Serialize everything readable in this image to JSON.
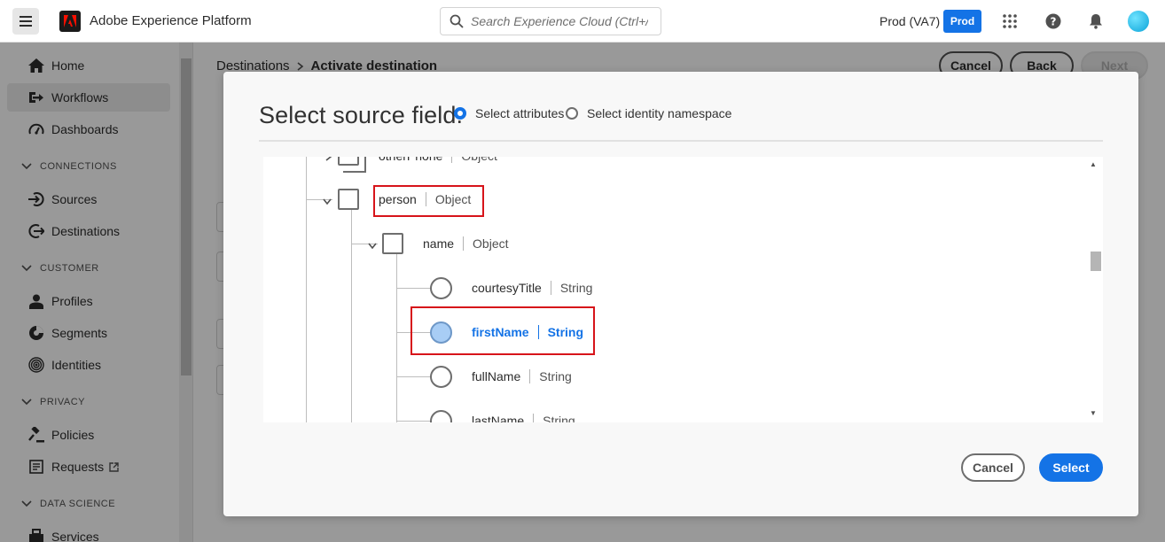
{
  "header": {
    "app_title": "Adobe Experience Platform",
    "search_placeholder": "Search Experience Cloud (Ctrl+/)",
    "sandbox_name": "Prod (VA7)",
    "sandbox_badge": "Prod"
  },
  "sidebar": {
    "home": "Home",
    "workflows": "Workflows",
    "dashboards": "Dashboards",
    "sec_connections": "CONNECTIONS",
    "sources": "Sources",
    "destinations": "Destinations",
    "sec_customer": "CUSTOMER",
    "profiles": "Profiles",
    "segments": "Segments",
    "identities": "Identities",
    "sec_privacy": "PRIVACY",
    "policies": "Policies",
    "requests": "Requests",
    "sec_data_science": "DATA SCIENCE",
    "services": "Services"
  },
  "page": {
    "breadcrumb_parent": "Destinations",
    "breadcrumb_current": "Activate destination",
    "cancel_label": "Cancel",
    "back_label": "Back",
    "next_label": "Next"
  },
  "dialog": {
    "title": "Select source field.",
    "option_attributes": "Select attributes",
    "option_identity": "Select identity namespace",
    "tree": {
      "otherphone": {
        "name": "otherPhone",
        "type": "Object"
      },
      "person": {
        "name": "person",
        "type": "Object"
      },
      "name": {
        "name": "name",
        "type": "Object"
      },
      "courtesytitle": {
        "name": "courtesyTitle",
        "type": "String"
      },
      "firstname": {
        "name": "firstName",
        "type": "String"
      },
      "fullname": {
        "name": "fullName",
        "type": "String"
      },
      "lastname": {
        "name": "lastName",
        "type": "String"
      }
    },
    "cancel_label": "Cancel",
    "select_label": "Select"
  },
  "colors": {
    "accent": "#1473e6",
    "highlight": "#d7141a",
    "selected_radio": "#a8cdf5"
  },
  "icons": [
    "menu-icon",
    "adobe-logo-icon",
    "search-icon",
    "apps-grid-icon",
    "help-icon",
    "bell-icon",
    "home-icon",
    "workflows-icon",
    "dashboards-icon",
    "sources-icon",
    "destinations-icon",
    "profiles-icon",
    "segments-icon",
    "identities-icon",
    "policies-icon",
    "requests-icon",
    "external-link-icon",
    "services-icon",
    "chevron-down-icon"
  ]
}
